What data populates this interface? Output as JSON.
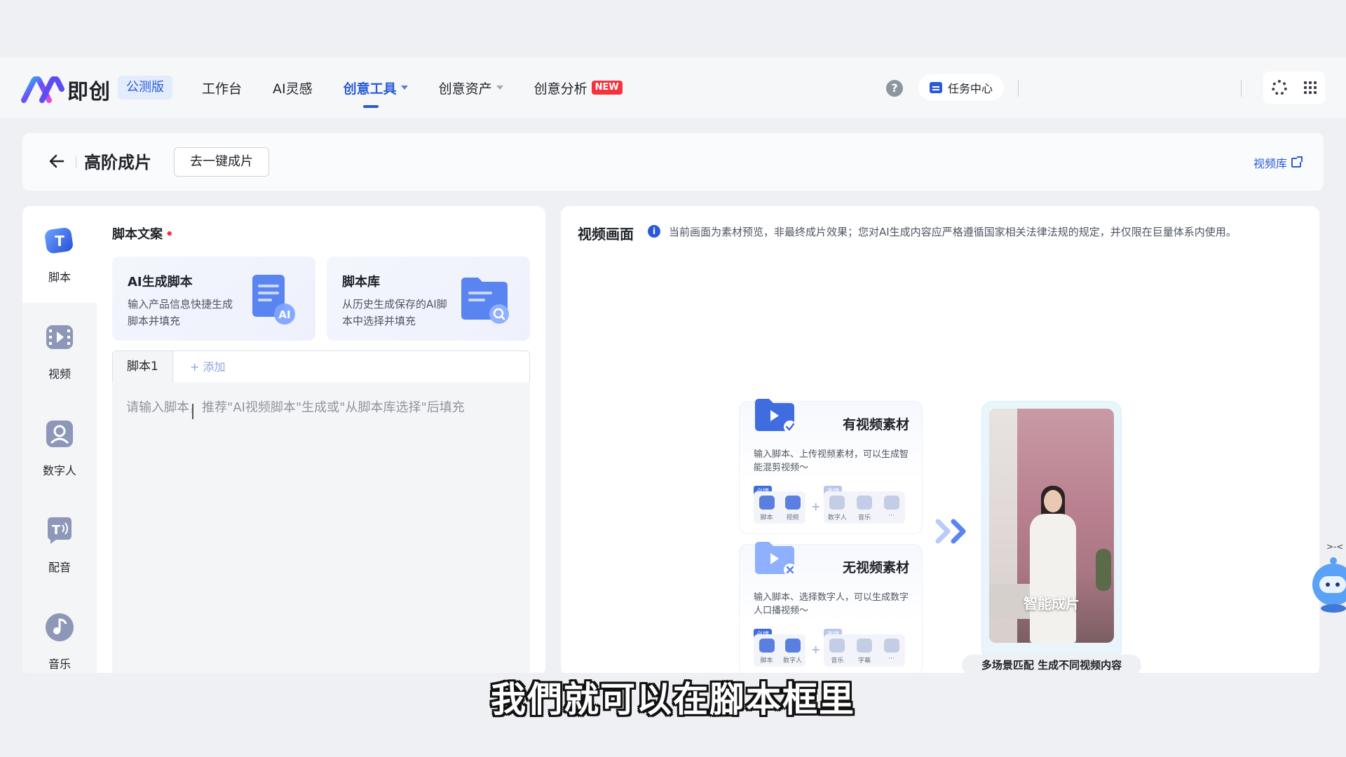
{
  "brand": {
    "name": "即创",
    "beta": "公测版",
    "logo_icon": "jichuang-logo"
  },
  "nav": {
    "items": [
      {
        "label": "工作台",
        "active": false,
        "dropdown": false
      },
      {
        "label": "AI灵感",
        "active": false,
        "dropdown": false
      },
      {
        "label": "创意工具",
        "active": true,
        "dropdown": true
      },
      {
        "label": "创意资产",
        "active": false,
        "dropdown": true
      },
      {
        "label": "创意分析",
        "active": false,
        "dropdown": false,
        "badge": "NEW"
      }
    ],
    "help_glyph": "?",
    "task_center": "任务中心"
  },
  "header": {
    "title": "高阶成片",
    "oneclick_button": "去一键成片",
    "video_library_link": "视频库"
  },
  "sidebar": {
    "items": [
      {
        "label": "脚本",
        "icon": "script-icon",
        "active": true
      },
      {
        "label": "视频",
        "icon": "video-icon",
        "active": false
      },
      {
        "label": "数字人",
        "icon": "digital-human-icon",
        "active": false
      },
      {
        "label": "配音",
        "icon": "dubbing-icon",
        "active": false
      },
      {
        "label": "音乐",
        "icon": "music-icon",
        "active": false
      }
    ]
  },
  "script_section": {
    "label": "脚本文案",
    "required_mark": "•",
    "cards": [
      {
        "title": "AI生成脚本",
        "desc": "输入产品信息快捷生成脚本并填充",
        "icon": "document-ai-icon"
      },
      {
        "title": "脚本库",
        "desc": "从历史生成保存的AI脚本中选择并填充",
        "icon": "folder-search-icon"
      }
    ],
    "tabs": [
      {
        "label": "脚本1"
      }
    ],
    "add_tab": "+ 添加",
    "placeholder": "请输入脚本，推荐\"AI视频脚本\"生成或\"从脚本库选择\"后填充"
  },
  "video_section": {
    "title": "视频画面",
    "info_glyph": "i",
    "notice": "当前画面为素材预览，非最终成片效果；您对AI生成内容应严格遵循国家相关法律法规的规定，并仅限在巨量体系内使用。",
    "mode_cards": [
      {
        "title": "有视频素材",
        "desc": "输入脚本、上传视频素材，可以生成智能混剪视频～",
        "required_tag": "必填",
        "optional_tag": "选填",
        "required_items": [
          "脚本",
          "视频"
        ],
        "optional_items": [
          "数字人",
          "音乐",
          "···"
        ]
      },
      {
        "title": "无视频素材",
        "desc": "输入脚本、选择数字人，可以生成数字人口播视频～",
        "required_tag": "必填",
        "optional_tag": "选填",
        "required_items": [
          "脚本",
          "数字人"
        ],
        "optional_items": [
          "音乐",
          "字幕",
          "···"
        ]
      }
    ],
    "preview_label": "智能成片",
    "preview_caption": "多场景匹配 生成不同视频内容"
  },
  "subtitle": "我們就可以在腳本框里",
  "colors": {
    "accent": "#2a5bd7",
    "badge_red": "#f5333f",
    "bg": "#eef0f4"
  }
}
